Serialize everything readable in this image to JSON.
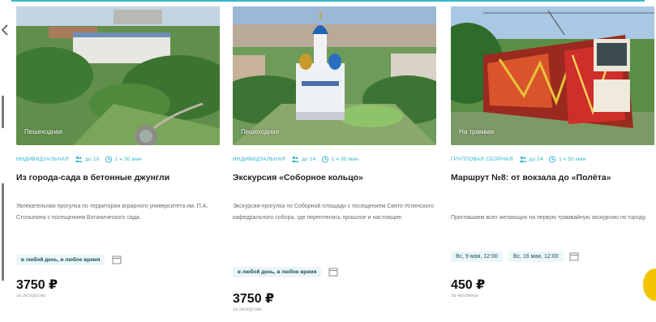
{
  "colors": {
    "accent": "#2eb2cc",
    "chip_bg": "#eaf6f8",
    "fab": "#f5c400"
  },
  "icons": {
    "group": "people-icon",
    "duration": "clock-icon",
    "calendar": "calendar-icon",
    "side": "chevron-left-icon"
  },
  "cards": [
    {
      "place": "Пешеходная",
      "type": "индивидуальная",
      "group": "до 10",
      "duration": "1 ч 30 мин",
      "title": "Из города-сада в бетонные джунгли",
      "description": "Увлекательная прогулка по территории аграрного университета им. П.А. Столыпина с посещением Ботанического сада.",
      "when": "в любой день, в любое время",
      "price": "3750 ₽",
      "per": "за экскурсию"
    },
    {
      "place": "Пешеходная",
      "type": "индивидуальная",
      "group": "до 14",
      "duration": "1 ч 30 мин",
      "title": "Экскурсия «Соборное кольцо»",
      "description": "Экскурсия-прогулка по Соборной площади с посещением Свято-Успенского кафедрального собора, где переплелись прошлое и настоящее.",
      "when": "в любой день, в любое время",
      "price": "3750 ₽",
      "per": "за экскурсию"
    },
    {
      "place": "На трамвае",
      "type": "групповая сборная",
      "group": "до 24",
      "duration": "1 ч 50 мин",
      "title": "Маршрут №8: от вокзала до «Полёта»",
      "description": "Приглашаем всех желающих на первую трамвайную экскурсию по городу.",
      "dates": [
        "Вс, 9 мая, 12:00",
        "Вс, 16 мая, 12:00"
      ],
      "price": "450 ₽",
      "per": "за человека"
    }
  ]
}
